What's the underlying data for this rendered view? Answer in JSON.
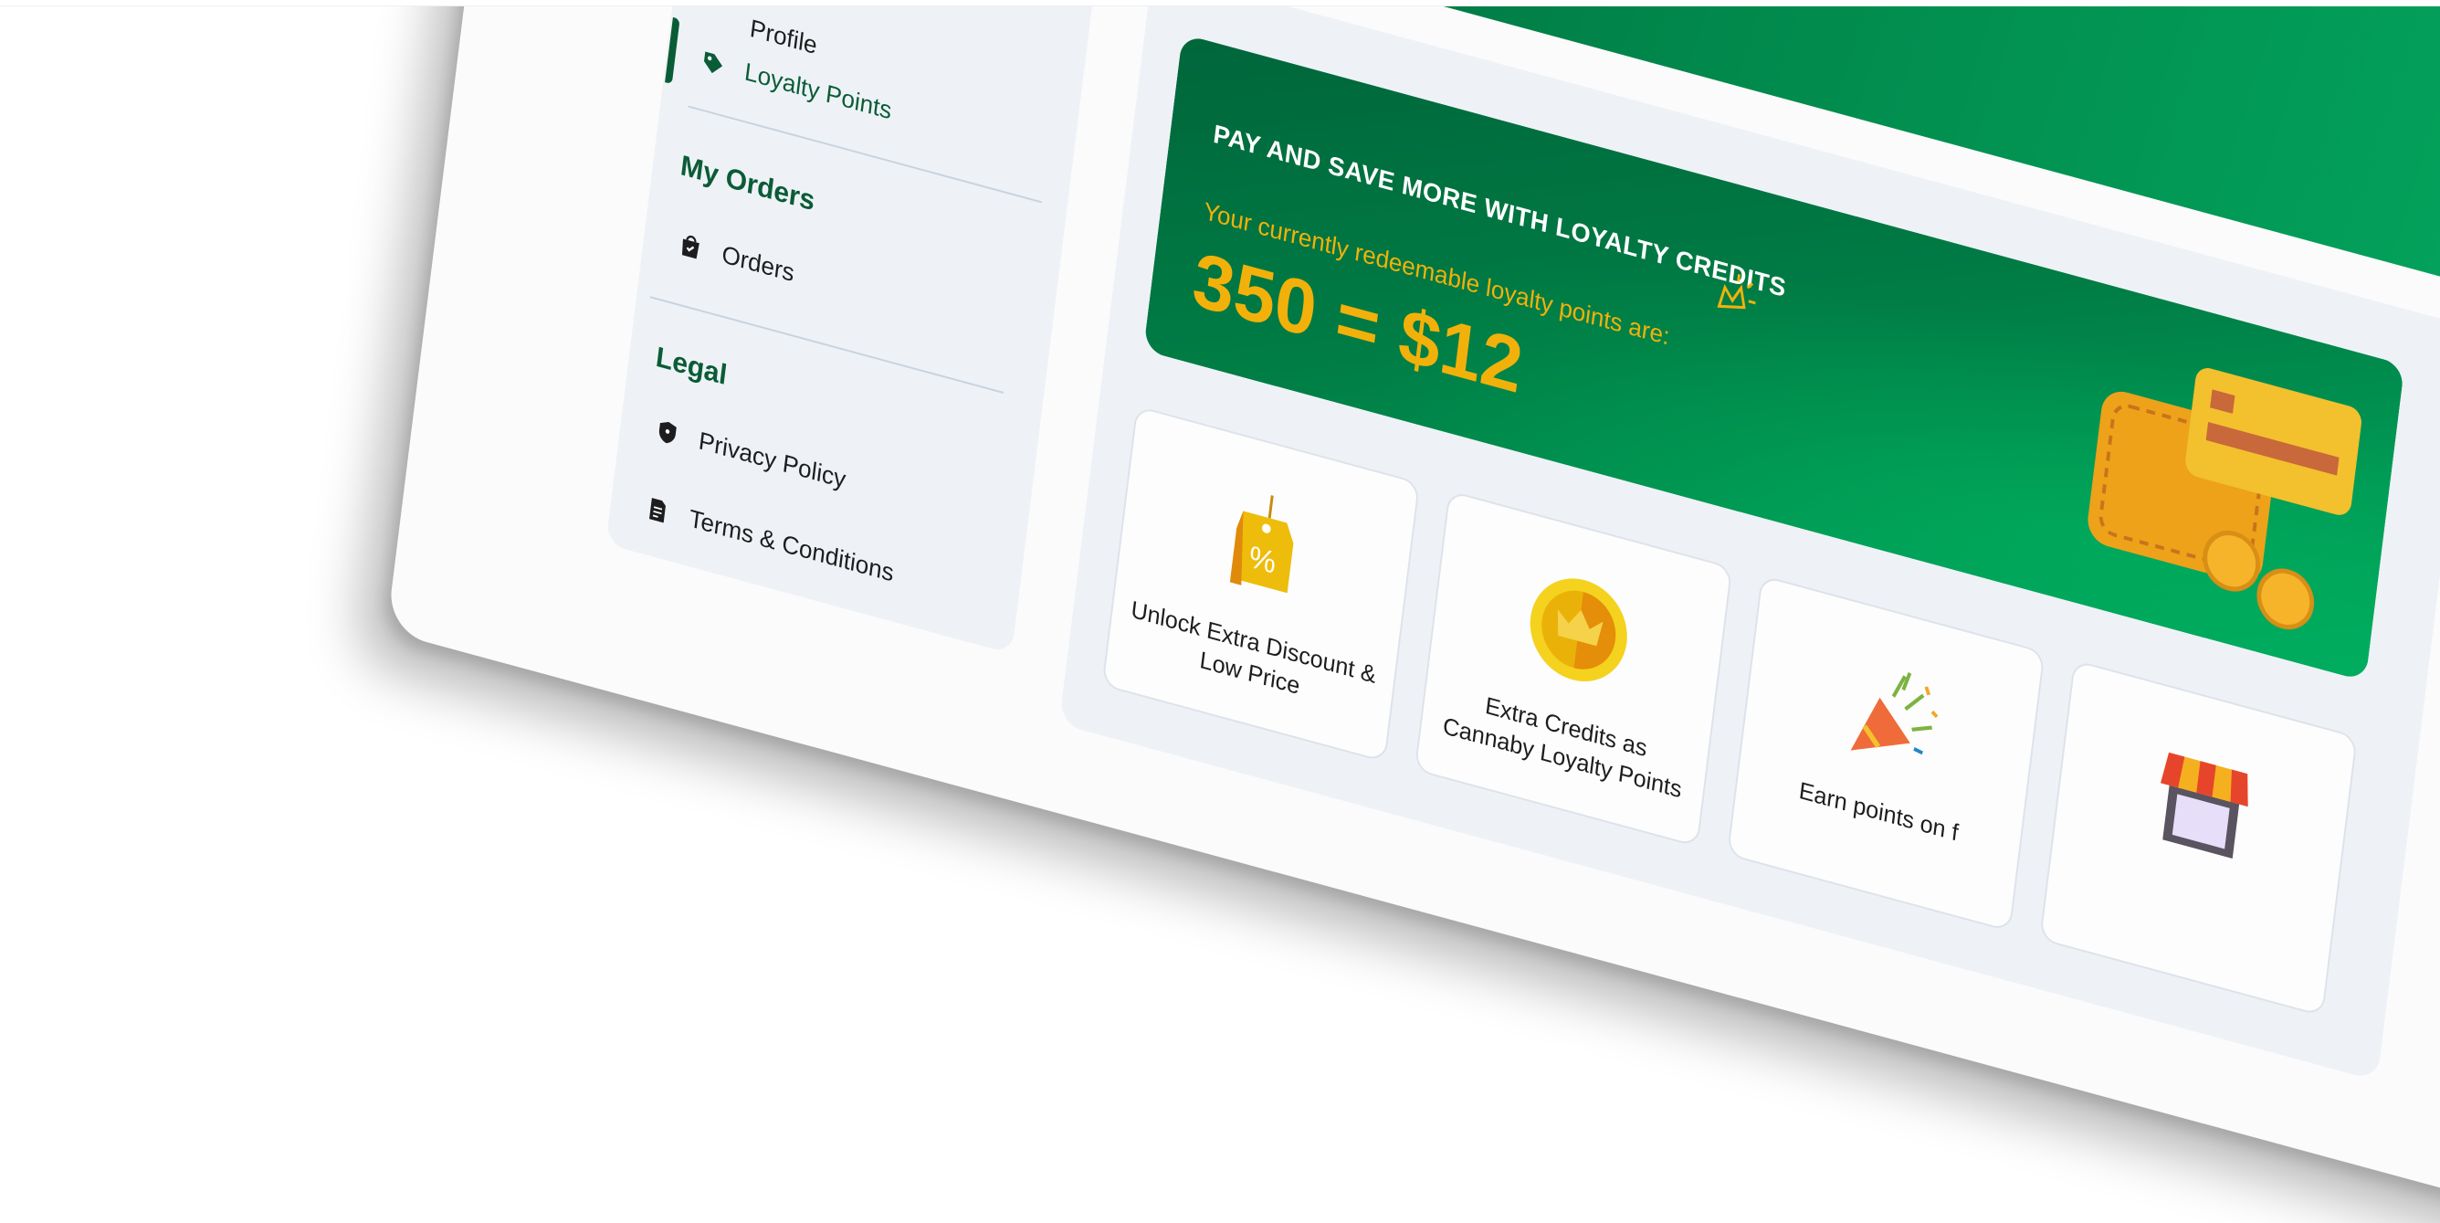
{
  "sidebar": {
    "profile_item": "Profile",
    "loyalty_item": "Loyalty Points",
    "orders_heading": "My Orders",
    "orders_item": "Orders",
    "legal_heading": "Legal",
    "privacy_item": "Privacy Policy",
    "terms_item": "Terms & Conditions"
  },
  "banner": {
    "title": "PAY AND SAVE MORE WITH LOYALTY CREDITS",
    "subtitle": "Your currently redeemable loyalty points are:",
    "points_value": "350 = $12"
  },
  "cards": [
    {
      "label": "Unlock Extra Discount & Low Price",
      "icon": "discount-tag-icon"
    },
    {
      "label": "Extra Credits as Cannaby Loyalty Points",
      "icon": "crown-coin-icon"
    },
    {
      "label": "Earn points on f",
      "icon": "party-popper-icon"
    },
    {
      "label": "",
      "icon": "shop-icon"
    }
  ],
  "colors": {
    "brand_green": "#0a5c36",
    "banner_green": "#008a4c",
    "accent_yellow": "#f2b10a",
    "panel_bg": "#eef2f6"
  }
}
